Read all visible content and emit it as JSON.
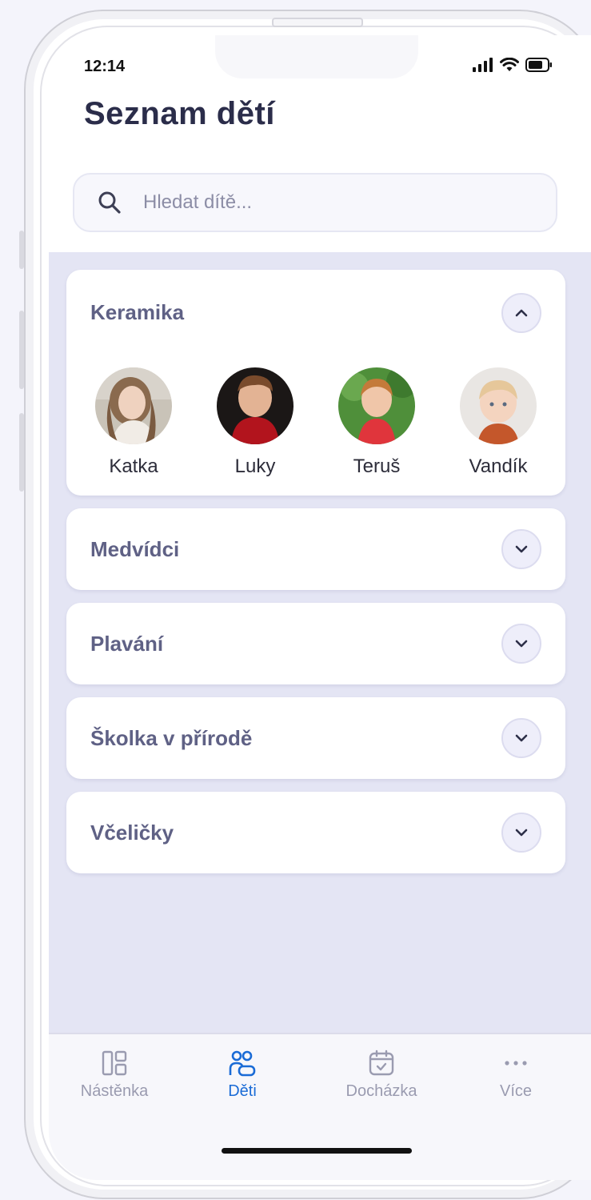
{
  "status_bar": {
    "time": "12:14"
  },
  "header": {
    "title": "Seznam dětí"
  },
  "search": {
    "placeholder": "Hledat dítě..."
  },
  "groups": [
    {
      "name": "Keramika",
      "expanded": true,
      "children": [
        {
          "name": "Katka"
        },
        {
          "name": "Luky"
        },
        {
          "name": "Teruš"
        },
        {
          "name": "Vandík"
        }
      ]
    },
    {
      "name": "Medvídci",
      "expanded": false
    },
    {
      "name": "Plavání",
      "expanded": false
    },
    {
      "name": "Školka v přírodě",
      "expanded": false
    },
    {
      "name": "Včeličky",
      "expanded": false
    }
  ],
  "tabbar": {
    "tabs": [
      {
        "label": "Nástěnka",
        "icon": "dashboard-icon"
      },
      {
        "label": "Děti",
        "icon": "children-icon",
        "active": true
      },
      {
        "label": "Docházka",
        "icon": "calendar-icon"
      },
      {
        "label": "Více",
        "icon": "more-icon"
      }
    ]
  },
  "colors": {
    "accent": "#1a6bd6",
    "title": "#2b2d4a",
    "group_title": "#5f6185",
    "list_background": "#e4e5f4"
  }
}
